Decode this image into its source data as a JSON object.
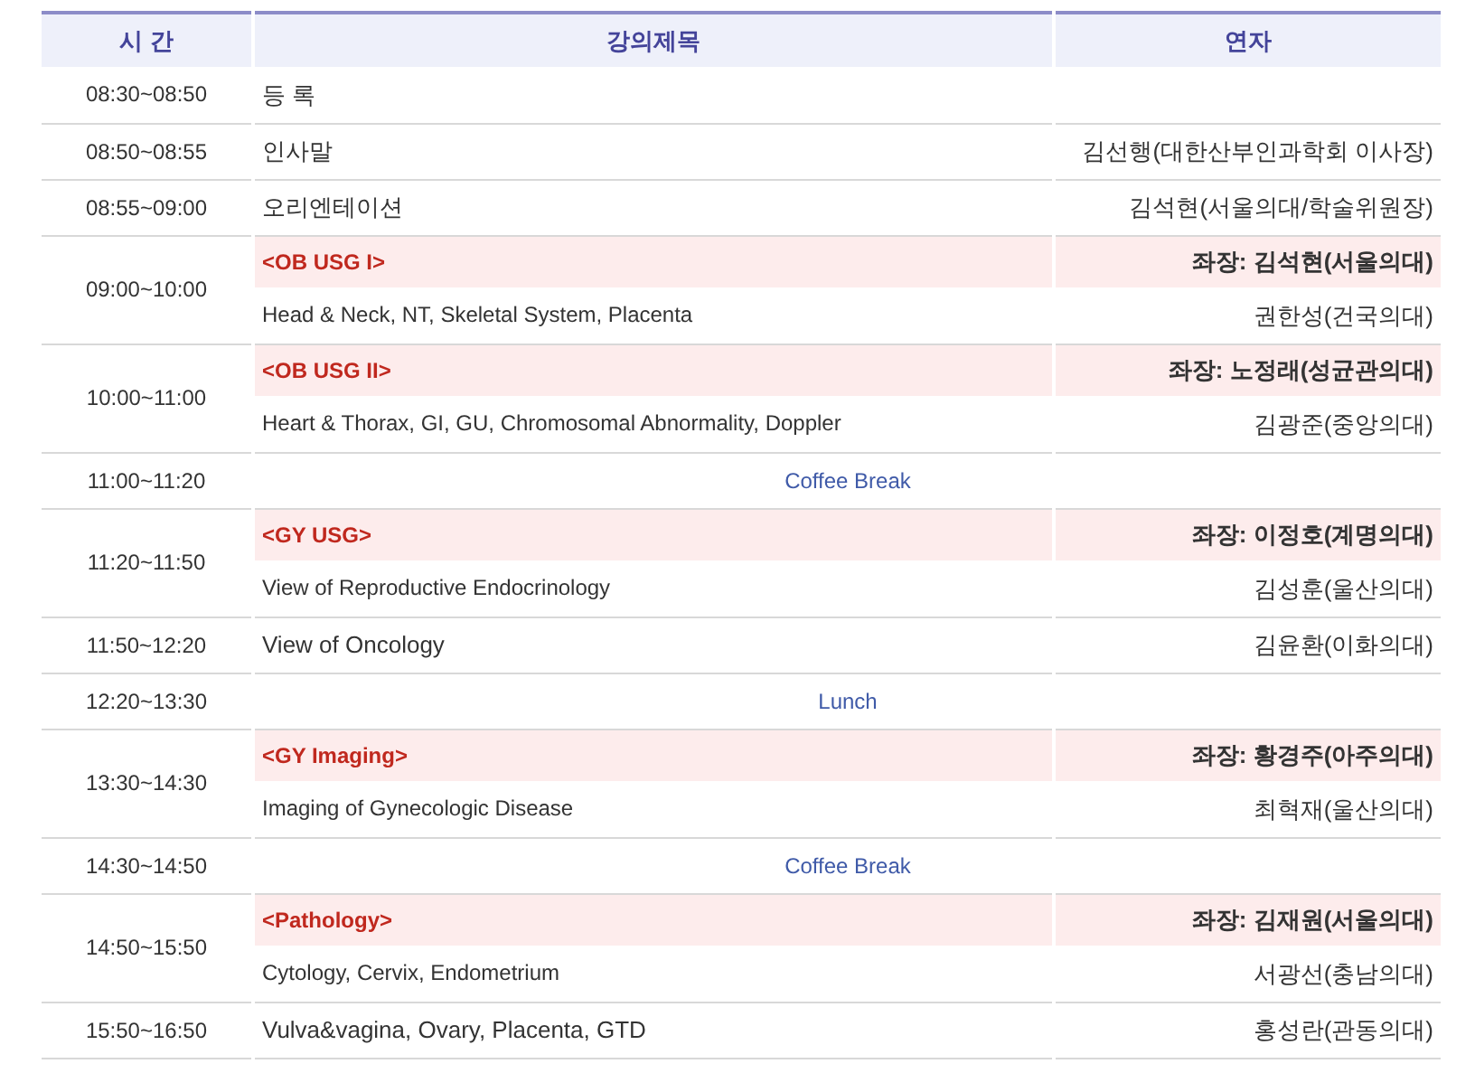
{
  "columns": [
    "시 간",
    "강의제목",
    "연자"
  ],
  "rows": [
    {
      "kind": "plain",
      "time": "08:30~08:50",
      "title": "등 록"
    },
    {
      "kind": "plain",
      "time": "08:50~08:55",
      "title": "인사말",
      "speaker": "김선행(대한산부인과학회 이사장)"
    },
    {
      "kind": "plain",
      "time": "08:55~09:00",
      "title": "오리엔테이션",
      "speaker": "김석현(서울의대/학술위원장)"
    },
    {
      "kind": "session",
      "time": "09:00~10:00",
      "session": "<OB USG I>",
      "chair": "좌장: 김석현(서울의대)",
      "talks": [
        {
          "title": "Head & Neck, NT, Skeletal System, Placenta",
          "speaker": "권한성(건국의대)"
        }
      ]
    },
    {
      "kind": "session",
      "time": "10:00~11:00",
      "session": "<OB USG II>",
      "chair": "좌장: 노정래(성균관의대)",
      "talks": [
        {
          "title": "Heart & Thorax, GI, GU, Chromosomal Abnormality, Doppler",
          "speaker": "김광준(중앙의대)"
        }
      ]
    },
    {
      "kind": "break",
      "time": "11:00~11:20",
      "title": "Coffee Break"
    },
    {
      "kind": "session",
      "time": "11:20~11:50",
      "session": "<GY USG>",
      "chair": "좌장: 이정호(계명의대)",
      "talks": [
        {
          "title": "View of Reproductive Endocrinology",
          "speaker": "김성훈(울산의대)"
        }
      ]
    },
    {
      "kind": "plain",
      "time": "11:50~12:20",
      "title": "View of Oncology",
      "speaker": "김윤환(이화의대)"
    },
    {
      "kind": "break",
      "time": "12:20~13:30",
      "title": "Lunch"
    },
    {
      "kind": "session",
      "time": "13:30~14:30",
      "session": "<GY Imaging>",
      "chair": "좌장: 황경주(아주의대)",
      "talks": [
        {
          "title": "Imaging of Gynecologic Disease",
          "speaker": "최혁재(울산의대)"
        }
      ]
    },
    {
      "kind": "break",
      "time": "14:30~14:50",
      "title": "Coffee Break"
    },
    {
      "kind": "session",
      "time": "14:50~15:50",
      "session": "<Pathology>",
      "chair": "좌장: 김재원(서울의대)",
      "talks": [
        {
          "title": "Cytology, Cervix, Endometrium",
          "speaker": "서광선(충남의대)"
        }
      ]
    },
    {
      "kind": "plain",
      "time": "15:50~16:50",
      "title": "Vulva&vagina, Ovary, Placenta, GTD",
      "speaker": "홍성란(관동의대)"
    }
  ]
}
